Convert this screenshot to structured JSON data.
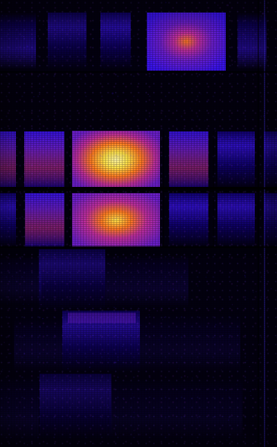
{
  "image": {
    "description": "",
    "palette": {
      "background": "#02000f",
      "deep_blue": "#120086",
      "blue_violet": "#3d14ff",
      "purple": "#7220d8",
      "magenta": "#c22f9d",
      "orange": "#ff7a21",
      "yellow": "#ffe34a",
      "white_yellow": "#fff6a6"
    }
  }
}
